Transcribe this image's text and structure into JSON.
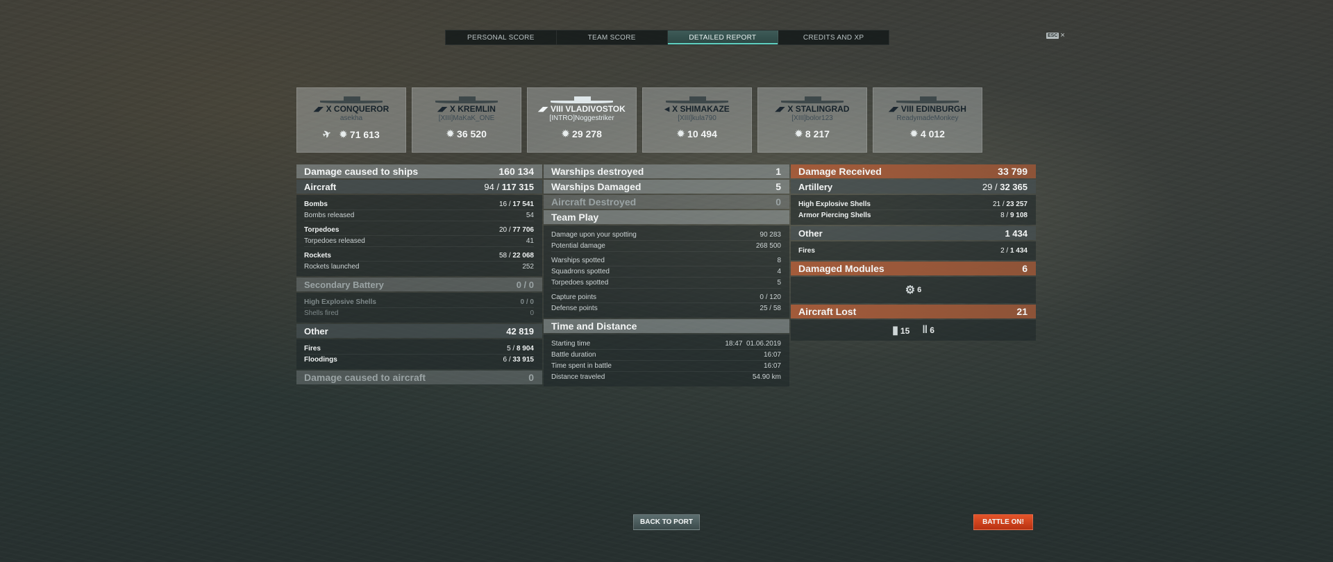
{
  "tabs": [
    {
      "label": "PERSONAL SCORE",
      "active": false
    },
    {
      "label": "TEAM SCORE",
      "active": false
    },
    {
      "label": "DETAILED REPORT",
      "active": true
    },
    {
      "label": "CREDITS AND XP",
      "active": false
    }
  ],
  "esc": {
    "key": "ESC",
    "close": "×"
  },
  "ships": [
    {
      "name": "X CONQUEROR",
      "player": "asekha",
      "score": "71 613",
      "highlight": false
    },
    {
      "name": "X KREMLIN",
      "player": "[XIII]MaKaK_ONE",
      "score": "36 520",
      "highlight": false
    },
    {
      "name": "VIII VLADIVOSTOK",
      "player": "[INTRO]Noggestriker",
      "score": "29 278",
      "highlight": true
    },
    {
      "name": "X SHIMAKAZE",
      "player": "[XIII]kula790",
      "score": "10 494",
      "highlight": false
    },
    {
      "name": "X STALINGRAD",
      "player": "[XIII]bolor123",
      "score": "8 217",
      "highlight": false
    },
    {
      "name": "VIII EDINBURGH",
      "player": "ReadymadeMonkey",
      "score": "4 012",
      "highlight": false
    }
  ],
  "col1": {
    "damage_ships": {
      "label": "Damage caused to ships",
      "value": "160 134"
    },
    "aircraft": {
      "label": "Aircraft",
      "count": "94 /",
      "value": "117 315"
    },
    "bombs": {
      "label": "Bombs",
      "count": "16 /",
      "value": "17 541"
    },
    "bombs_released": {
      "label": "Bombs released",
      "value": "54"
    },
    "torpedoes": {
      "label": "Torpedoes",
      "count": "20 /",
      "value": "77 706"
    },
    "torpedoes_released": {
      "label": "Torpedoes released",
      "value": "41"
    },
    "rockets": {
      "label": "Rockets",
      "count": "58 /",
      "value": "22 068"
    },
    "rockets_launched": {
      "label": "Rockets launched",
      "value": "252"
    },
    "secondary": {
      "label": "Secondary Battery",
      "value": "0 / 0"
    },
    "he_shells": {
      "label": "High Explosive Shells",
      "value": "0 / 0"
    },
    "shells_fired": {
      "label": "Shells fired",
      "value": "0"
    },
    "other": {
      "label": "Other",
      "value": "42 819"
    },
    "fires": {
      "label": "Fires",
      "count": "5 /",
      "value": "8 904"
    },
    "floodings": {
      "label": "Floodings",
      "count": "6 /",
      "value": "33 915"
    },
    "damage_aircraft": {
      "label": "Damage caused to aircraft",
      "value": "0"
    }
  },
  "col2": {
    "warships_destroyed": {
      "label": "Warships destroyed",
      "value": "1"
    },
    "warships_damaged": {
      "label": "Warships Damaged",
      "value": "5"
    },
    "aircraft_destroyed": {
      "label": "Aircraft Destroyed",
      "value": "0"
    },
    "team_play": {
      "label": "Team Play"
    },
    "spotting_damage": {
      "label": "Damage upon your spotting",
      "value": "90 283"
    },
    "potential_damage": {
      "label": "Potential damage",
      "value": "268 500"
    },
    "warships_spotted": {
      "label": "Warships spotted",
      "value": "8"
    },
    "squadrons_spotted": {
      "label": "Squadrons spotted",
      "value": "4"
    },
    "torpedoes_spotted": {
      "label": "Torpedoes spotted",
      "value": "5"
    },
    "capture_points": {
      "label": "Capture points",
      "value": "0 / 120"
    },
    "defense_points": {
      "label": "Defense points",
      "value": "25 / 58"
    },
    "time_distance": {
      "label": "Time and Distance"
    },
    "starting_time": {
      "label": "Starting time",
      "value": "18:47  01.06.2019"
    },
    "battle_duration": {
      "label": "Battle duration",
      "value": "16:07"
    },
    "time_spent": {
      "label": "Time spent in battle",
      "value": "16:07"
    },
    "distance": {
      "label": "Distance traveled",
      "value": "54.90 km"
    }
  },
  "col3": {
    "damage_received": {
      "label": "Damage Received",
      "value": "33 799"
    },
    "artillery": {
      "label": "Artillery",
      "count": "29 /",
      "value": "32 365"
    },
    "he_shells": {
      "label": "High Explosive Shells",
      "count": "21 /",
      "value": "23 257"
    },
    "ap_shells": {
      "label": "Armor Piercing Shells",
      "count": "8 /",
      "value": "9 108"
    },
    "other": {
      "label": "Other",
      "value": "1 434"
    },
    "fires": {
      "label": "Fires",
      "count": "2 /",
      "value": "1 434"
    },
    "damaged_modules": {
      "label": "Damaged Modules",
      "value": "6"
    },
    "module_count": "6",
    "aircraft_lost": {
      "label": "Aircraft Lost",
      "value": "21"
    },
    "lost_bombers": "15",
    "lost_torpedo": "6"
  },
  "buttons": {
    "back_to_port": "BACK TO PORT",
    "battle_on": "BATTLE ON!"
  },
  "colors": {
    "accent": "#5fd0c0",
    "received": "#a75c3a",
    "battle": "#d8461d"
  },
  "icons": {
    "damage": "damage-icon",
    "plane": "plane-icon",
    "module": "module-icon",
    "bomber": "bomber-icon",
    "torpedo": "torpedo-bomber-icon"
  }
}
